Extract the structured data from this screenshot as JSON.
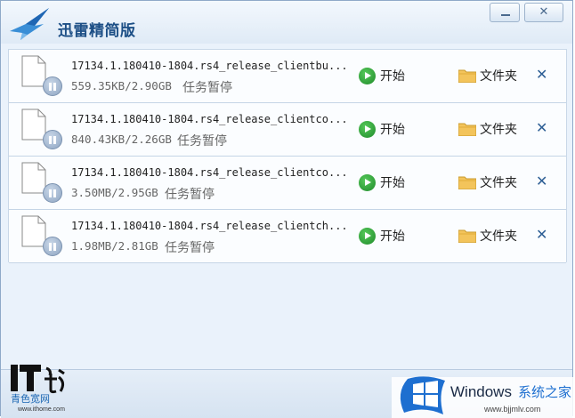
{
  "app": {
    "title": "迅雷精简版",
    "minimize_label": "—",
    "close_label": "✕"
  },
  "downloads": [
    {
      "filename": "17134.1.180410-1804.rs4_release_clientbu...",
      "size": "559.35KB/2.90GB",
      "status": "任务暂停",
      "start_label": "开始",
      "folder_label": "文件夹",
      "delete_label": "✕"
    },
    {
      "filename": "17134.1.180410-1804.rs4_release_clientco...",
      "size": "840.43KB/2.26GB",
      "status": "任务暂停",
      "start_label": "开始",
      "folder_label": "文件夹",
      "delete_label": "✕"
    },
    {
      "filename": "17134.1.180410-1804.rs4_release_clientco...",
      "size": "3.50MB/2.95GB",
      "status": "任务暂停",
      "start_label": "开始",
      "folder_label": "文件夹",
      "delete_label": "✕"
    },
    {
      "filename": "17134.1.180410-1804.rs4_release_clientch...",
      "size": "1.98MB/2.81GB",
      "status": "任务暂停",
      "start_label": "开始",
      "folder_label": "文件夹",
      "delete_label": "✕"
    }
  ],
  "watermarks": {
    "it_home": {
      "brand": "IT之家",
      "tagline": "青色宽网",
      "url": "www.ithome.com"
    },
    "windows": {
      "brand": "Windows",
      "tagline": "系统之家",
      "url": "www.bjjmlv.com"
    }
  },
  "icons": {
    "app_logo": "thunder-bird-icon",
    "start": "play-circle-icon",
    "pause": "pause-circle-icon",
    "folder": "folder-icon",
    "file": "file-icon",
    "delete": "close-icon"
  },
  "colors": {
    "title_text": "#1d4f86",
    "start_green": "#2aa236",
    "delete_blue": "#2e5f95",
    "window_bg": "#eaf2fb"
  }
}
